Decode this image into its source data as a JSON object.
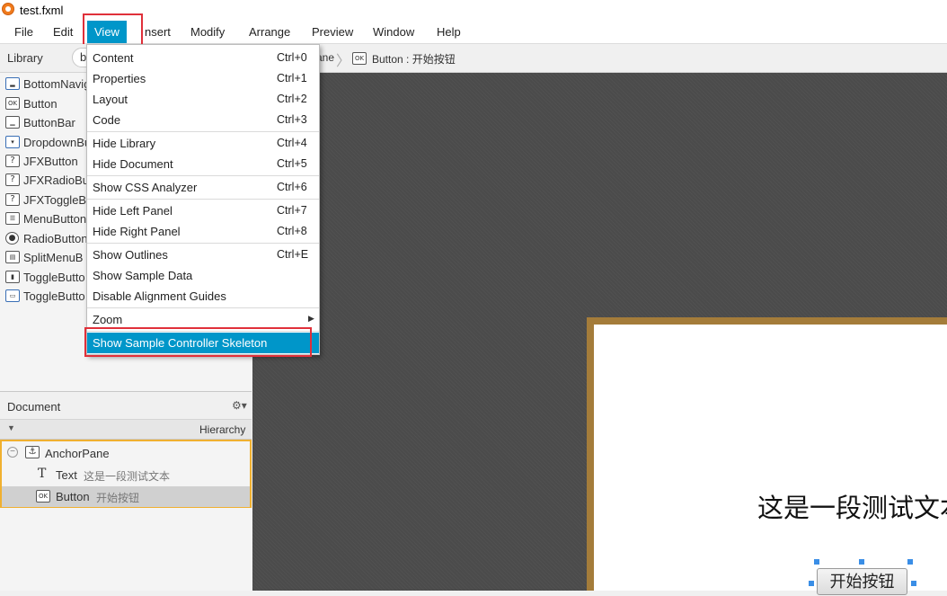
{
  "window": {
    "title": "test.fxml"
  },
  "menubar": {
    "items": [
      "File",
      "Edit",
      "View",
      "Insert",
      "Modify",
      "Arrange",
      "Preview",
      "Window",
      "Help"
    ],
    "insert_visible": "nsert"
  },
  "library": {
    "title": "Library",
    "search_value": "button",
    "search_visible": "b",
    "items": [
      {
        "label": "BottomNavigation",
        "icon": "bottom-navigation-icon"
      },
      {
        "label": "Button",
        "icon": "button-ok-icon"
      },
      {
        "label": "ButtonBar",
        "icon": "button-bar-icon"
      },
      {
        "label": "DropdownButton",
        "icon": "dropdown-button-icon"
      },
      {
        "label": "JFXButton",
        "icon": "unknown-component-icon"
      },
      {
        "label": "JFXRadioButton",
        "icon": "unknown-component-icon"
      },
      {
        "label": "JFXToggleButton",
        "icon": "unknown-component-icon"
      },
      {
        "label": "MenuButton",
        "icon": "menu-button-icon"
      },
      {
        "label": "RadioButton",
        "icon": "radio-button-icon"
      },
      {
        "label": "SplitMenuButton",
        "icon": "split-menu-button-icon"
      },
      {
        "label": "ToggleButton",
        "icon": "toggle-button-icon"
      },
      {
        "label": "ToggleButton",
        "icon": "toggle-button-alt-icon"
      }
    ],
    "visible_labels": [
      "BottomNavig",
      "Button",
      "ButtonBar",
      "DropdownBu",
      "JFXButton",
      "JFXRadioBu",
      "JFXToggleB",
      "MenuButton",
      "RadioButton",
      "SplitMenuB",
      "ToggleButto",
      "ToggleButto"
    ]
  },
  "breadcrumb": {
    "prev": "ane",
    "current_icon": "OK",
    "current": "Button : 开始按钮"
  },
  "view_menu": {
    "items": [
      {
        "label": "Content",
        "shortcut": "Ctrl+0"
      },
      {
        "label": "Properties",
        "shortcut": "Ctrl+1"
      },
      {
        "label": "Layout",
        "shortcut": "Ctrl+2"
      },
      {
        "label": "Code",
        "shortcut": "Ctrl+3"
      },
      {
        "label": "Hide Library",
        "shortcut": "Ctrl+4"
      },
      {
        "label": "Hide Document",
        "shortcut": "Ctrl+5"
      },
      {
        "label": "Show CSS Analyzer",
        "shortcut": "Ctrl+6"
      },
      {
        "label": "Hide Left Panel",
        "shortcut": "Ctrl+7"
      },
      {
        "label": "Hide Right Panel",
        "shortcut": "Ctrl+8"
      },
      {
        "label": "Show Outlines",
        "shortcut": "Ctrl+E"
      },
      {
        "label": "Show Sample Data",
        "shortcut": ""
      },
      {
        "label": "Disable Alignment Guides",
        "shortcut": ""
      },
      {
        "label": "Zoom",
        "shortcut": ""
      },
      {
        "label": "Show Sample Controller Skeleton",
        "shortcut": ""
      }
    ]
  },
  "document": {
    "title": "Document",
    "hierarchy_label": "Hierarchy",
    "tree": [
      {
        "type": "AnchorPane",
        "value": ""
      },
      {
        "type": "Text",
        "value": "这是一段测试文本"
      },
      {
        "type": "Button",
        "value": "开始按钮"
      }
    ]
  },
  "canvas": {
    "text": "这是一段测试文本",
    "button": "开始按钮"
  },
  "colors": {
    "accent": "#0096c9",
    "highlight_box": "#e0303a",
    "selection_border": "#f0b030",
    "canvas_bg": "#4b4b4b",
    "pane_border": "#a47c3a"
  }
}
